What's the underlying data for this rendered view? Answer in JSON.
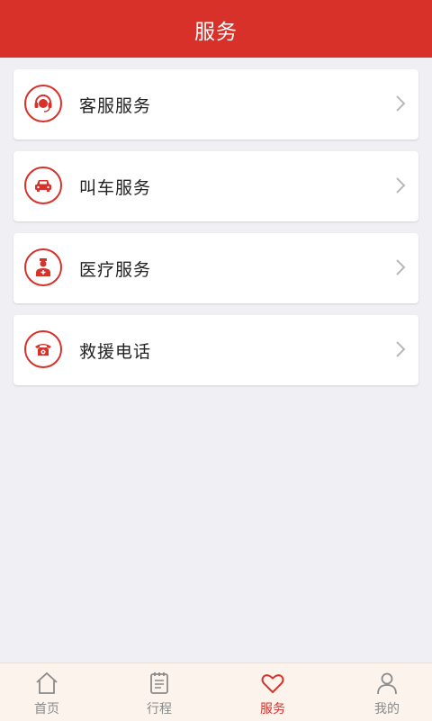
{
  "header": {
    "title": "服务"
  },
  "services": [
    {
      "label": "客服服务",
      "icon": "headset-icon"
    },
    {
      "label": "叫车服务",
      "icon": "car-icon"
    },
    {
      "label": "医疗服务",
      "icon": "doctor-icon"
    },
    {
      "label": "救援电话",
      "icon": "telephone-icon"
    }
  ],
  "tabs": [
    {
      "label": "首页",
      "icon": "home-icon",
      "active": false
    },
    {
      "label": "行程",
      "icon": "itinerary-icon",
      "active": false
    },
    {
      "label": "服务",
      "icon": "heart-icon",
      "active": true
    },
    {
      "label": "我的",
      "icon": "person-icon",
      "active": false
    }
  ],
  "colors": {
    "accent": "#d7312a",
    "background": "#efeff4",
    "tabbar": "#fbf3ec"
  }
}
